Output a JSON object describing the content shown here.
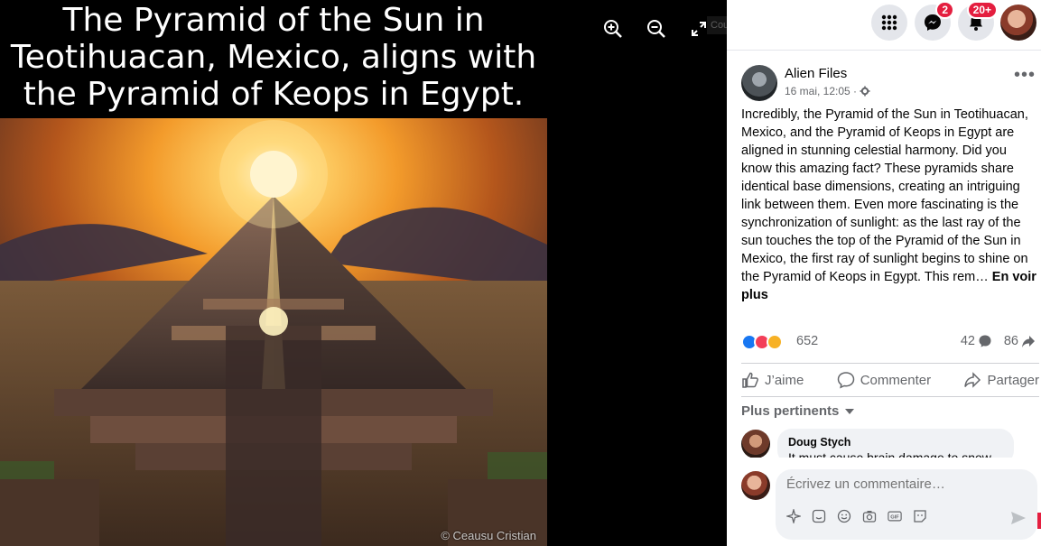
{
  "viewer": {
    "caption": "The Pyramid of the Sun in Teotihuacan, Mexico, aligns with the Pyramid of Keops in Egypt.",
    "credit": "© Ceausu Cristian",
    "zoom_in_icon": "zoom-in-icon",
    "zoom_out_icon": "zoom-out-icon",
    "fullscreen_icon": "fullscreen-icon",
    "fullscreen_tip": "Couvrir Plein écran"
  },
  "topbar": {
    "menu_icon": "grid-menu-icon",
    "messenger_badge": "2",
    "notifications_badge": "20+"
  },
  "post": {
    "page_name": "Alien Files",
    "meta": "16 mai, 12:05 ·",
    "text": "Incredibly, the Pyramid of the Sun in Teotihuacan, Mexico, and the Pyramid of Keops in Egypt are aligned in stunning celestial harmony. Did you know this amazing fact? These pyramids share identical base dimensions, creating an intriguing link between them. Even more fascinating is the synchronization of sunlight: as the last ray of the sun touches the top of the Pyramid of the Sun in Mexico, the first ray of sunlight begins to shine on the Pyramid of Keops in Egypt. This rem…",
    "see_more": "En voir plus",
    "reaction_count": "652",
    "comment_count": "42",
    "share_count": "86"
  },
  "actions": {
    "like": "J’aime",
    "comment": "Commenter",
    "share": "Partager"
  },
  "comments": {
    "sort_label": "Plus pertinents",
    "items": [
      {
        "author": "Doug Stych",
        "text": "It must cause brain damage to snow"
      }
    ]
  },
  "composer": {
    "placeholder": "Écrivez un commentaire…"
  },
  "colors": {
    "accent": "#1877f2",
    "badge": "#e41e3f",
    "muted": "#65676b"
  }
}
